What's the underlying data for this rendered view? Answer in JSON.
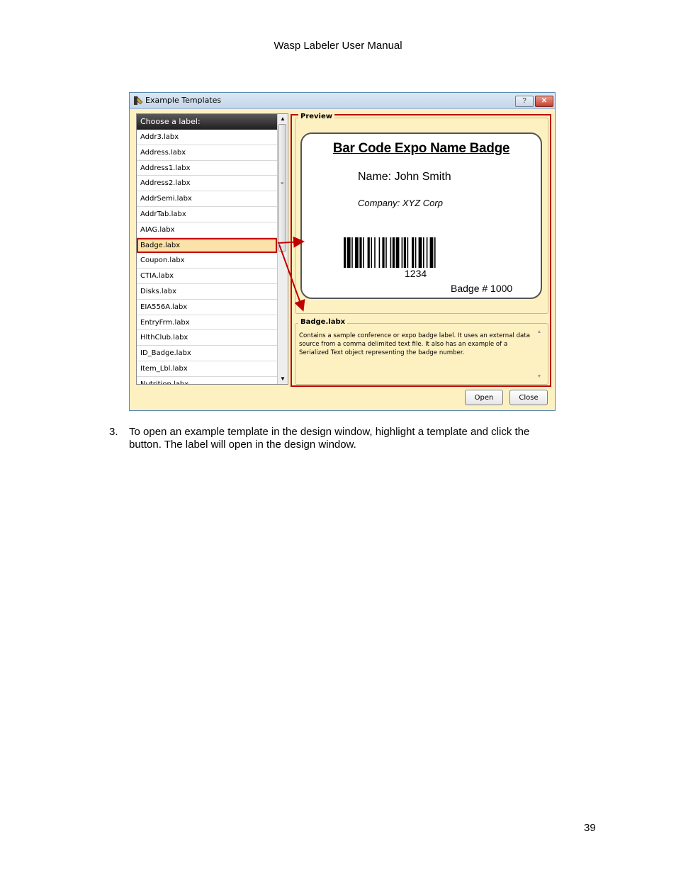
{
  "header": {
    "title": "Wasp Labeler User Manual"
  },
  "dialog": {
    "title": "Example Templates",
    "help_glyph": "?",
    "close_glyph": "✕",
    "list_header": "Choose a label:",
    "items": [
      "Addr3.labx",
      "Address.labx",
      "Address1.labx",
      "Address2.labx",
      "AddrSemi.labx",
      "AddrTab.labx",
      "AIAG.labx",
      "Badge.labx",
      "Coupon.labx",
      "CTIA.labx",
      "Disks.labx",
      "EIA556A.labx",
      "EntryFrm.labx",
      "HlthClub.labx",
      "ID_Badge.labx",
      "Item_Lbl.labx",
      "Nutrition.labx"
    ],
    "selected_index": 7,
    "preview_label": "Preview",
    "badge": {
      "title": "Bar Code Expo Name Badge",
      "name": "Name: John Smith",
      "company": "Company: XYZ Corp",
      "code": "1234",
      "number": "Badge # 1000"
    },
    "description_label": "Badge.labx",
    "description": "Contains a sample conference or expo badge label.  It uses an external data source from a comma delimited text file.  It also has an example of a Serialized Text object representing the badge number.",
    "open_label": "Open",
    "close_label": "Close"
  },
  "step": {
    "number": "3.",
    "text": "To open an example template in the design window, highlight a template and click the button.  The label will open in the design window."
  },
  "page_number": "39",
  "colors": {
    "highlight_red": "#c00000",
    "dialog_bg": "#fdf1c2",
    "selection_bg": "#fbe2a8"
  }
}
